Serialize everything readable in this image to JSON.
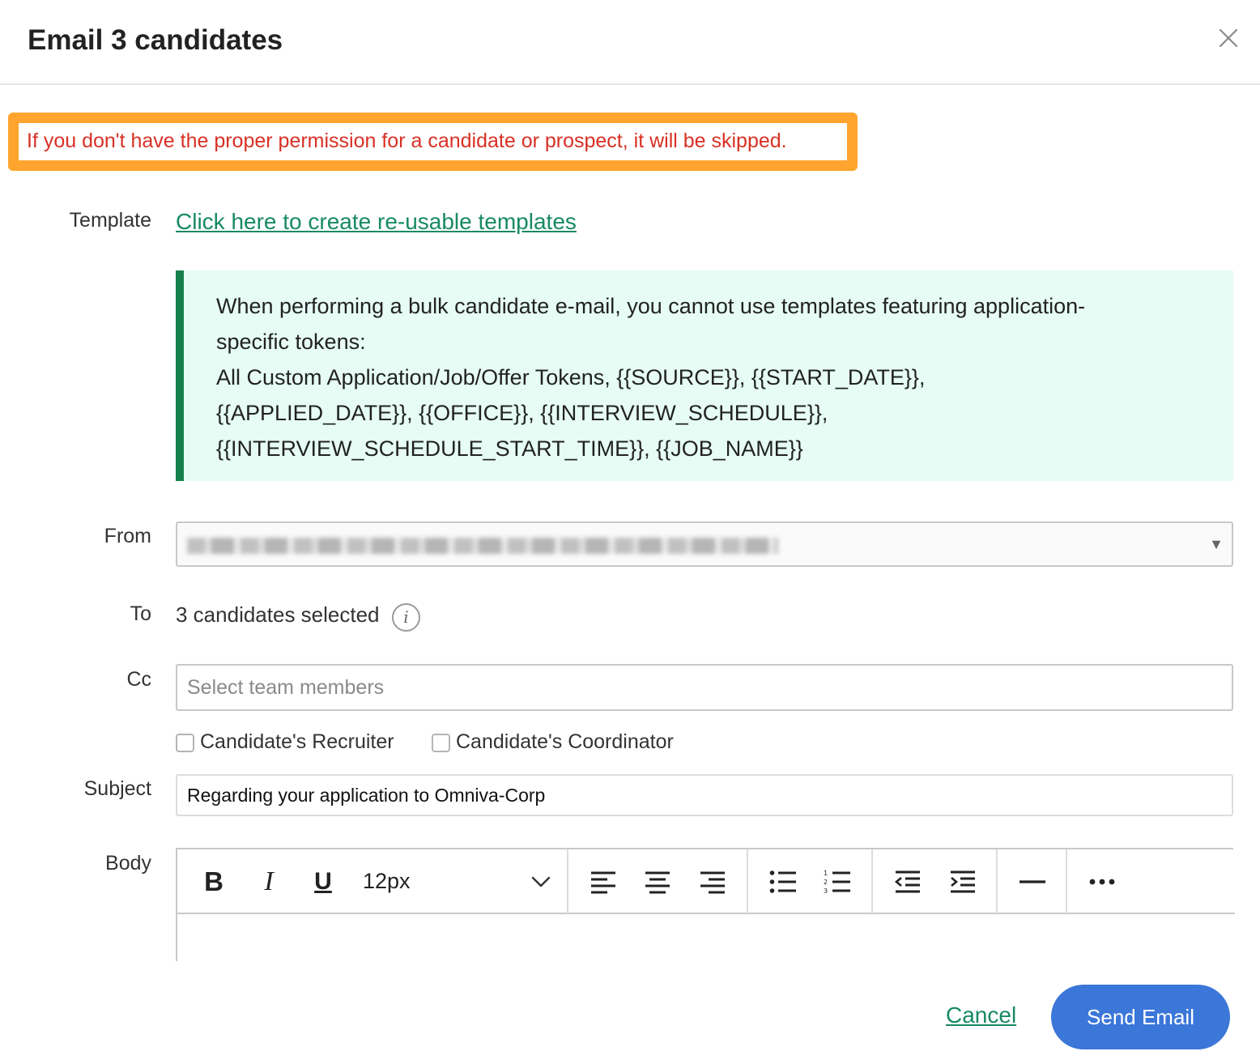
{
  "header": {
    "title": "Email 3 candidates"
  },
  "warning": {
    "text": "If you don't have the proper permission for a candidate or prospect, it will be skipped."
  },
  "template": {
    "label": "Template",
    "link_text": "Click here to create re-usable templates"
  },
  "notice": {
    "lines": [
      "When performing a bulk candidate e-mail, you cannot use templates featuring application-",
      "specific tokens:",
      "All Custom Application/Job/Offer Tokens, {{SOURCE}}, {{START_DATE}},",
      "{{APPLIED_DATE}}, {{OFFICE}}, {{INTERVIEW_SCHEDULE}},",
      "{{INTERVIEW_SCHEDULE_START_TIME}}, {{JOB_NAME}}"
    ]
  },
  "from": {
    "label": "From",
    "arrow": "▼"
  },
  "to": {
    "label": "To",
    "value": "3 candidates selected",
    "info_glyph": "i"
  },
  "cc": {
    "label": "Cc",
    "placeholder": "Select team members",
    "options": [
      {
        "label": "Candidate's Recruiter"
      },
      {
        "label": "Candidate's Coordinator"
      }
    ]
  },
  "subject": {
    "label": "Subject",
    "value": "Regarding your application to Omniva-Corp"
  },
  "body": {
    "label": "Body",
    "toolbar": {
      "bold_glyph": "B",
      "italic_glyph": "I",
      "underline_glyph": "U",
      "font_size": "12px"
    }
  },
  "footer": {
    "cancel_label": "Cancel",
    "send_label": "Send Email"
  },
  "colors": {
    "warning_border": "#ffa52f",
    "warning_text": "#d93025",
    "link": "#178a62",
    "notice_bg": "#e6fcf5",
    "notice_accent": "#14804a",
    "primary_button": "#3b76d9"
  },
  "icons": [
    "close-icon",
    "info-icon",
    "dropdown-arrow-icon",
    "bold-icon",
    "italic-icon",
    "underline-icon",
    "chevron-down-icon",
    "align-left-icon",
    "align-center-icon",
    "align-right-icon",
    "bullet-list-icon",
    "numbered-list-icon",
    "outdent-icon",
    "indent-icon",
    "horizontal-rule-icon",
    "more-icon"
  ]
}
